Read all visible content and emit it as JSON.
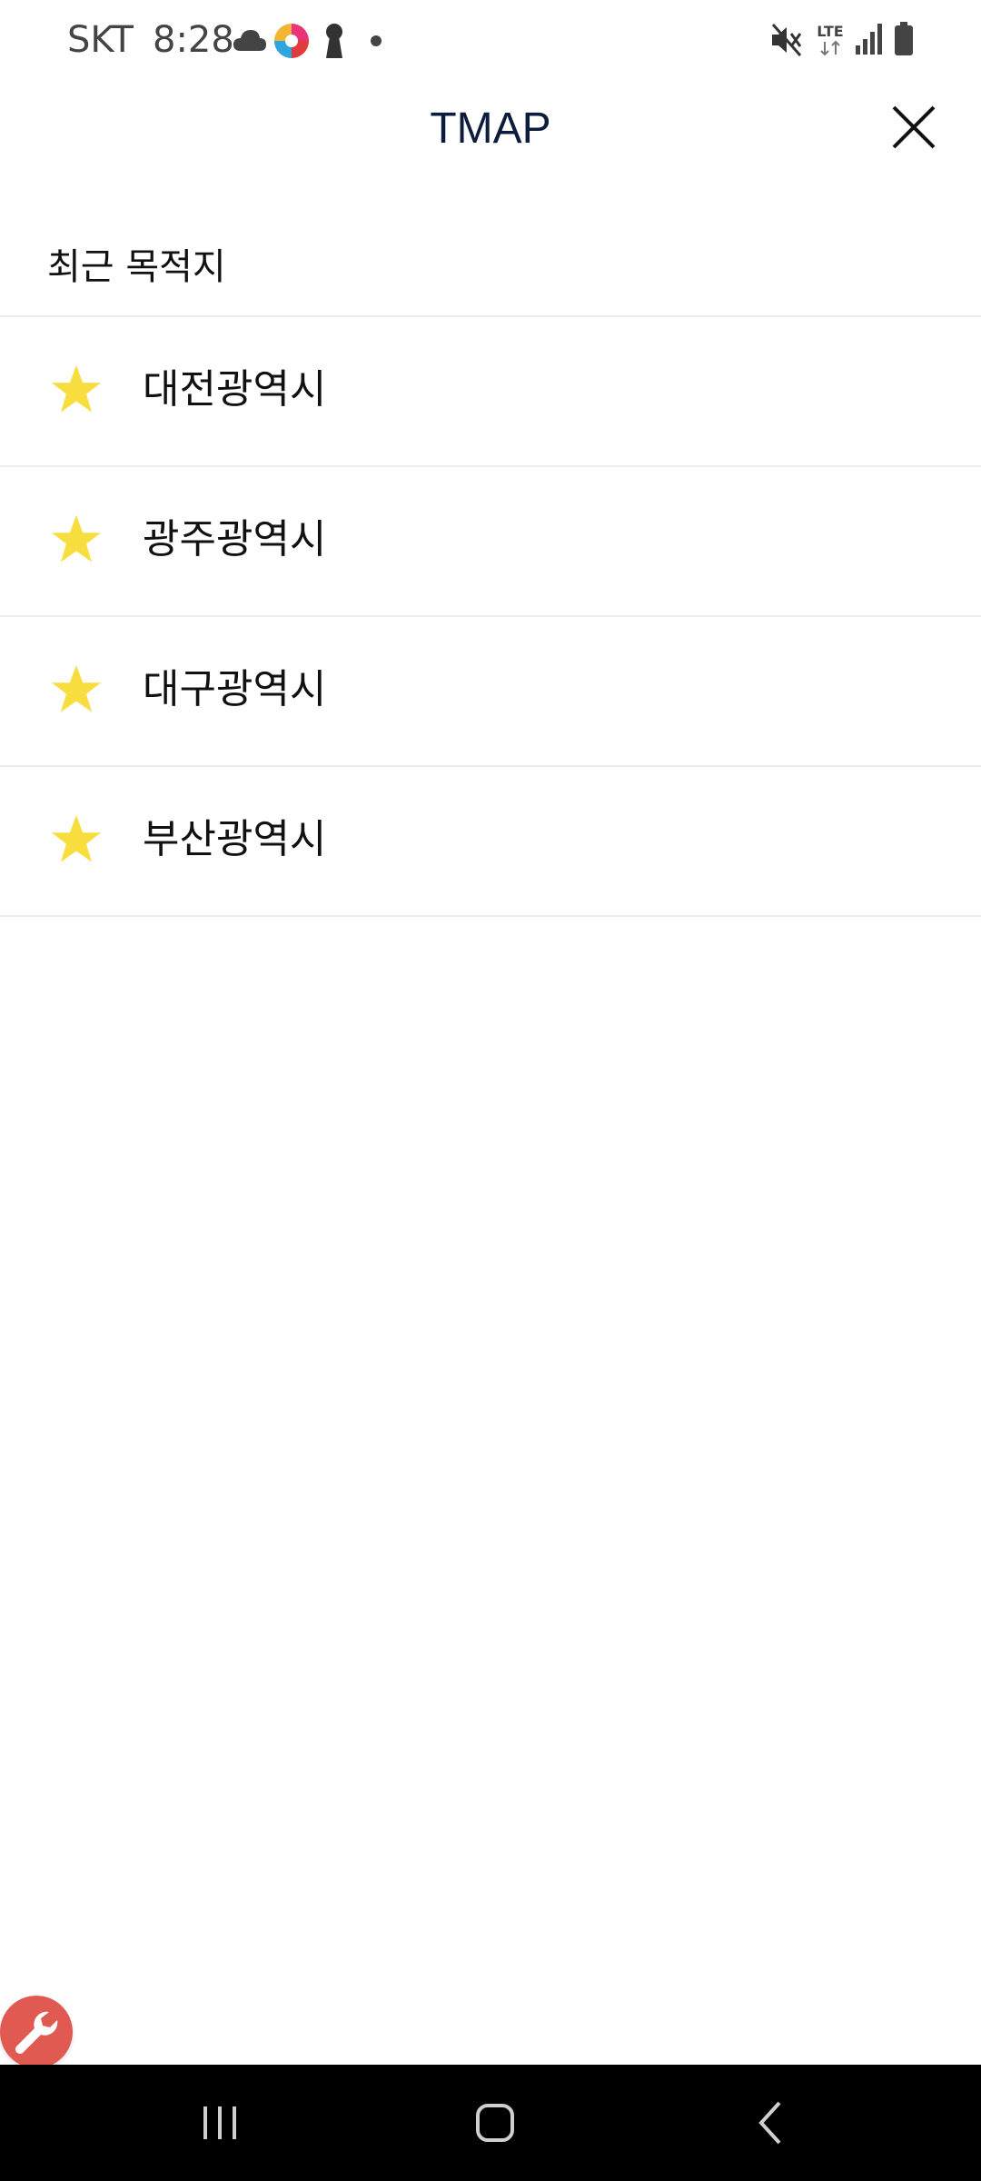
{
  "status_bar": {
    "carrier": "SKT",
    "time": "8:28",
    "icons": [
      "cloud-icon",
      "app-notification-icon",
      "keyhole-icon",
      "dot-icon",
      "mute-icon",
      "lte-icon",
      "signal-icon",
      "battery-icon"
    ],
    "lte_label": "LTE"
  },
  "header": {
    "title": "TMAP",
    "close_icon": "close-icon"
  },
  "section": {
    "title": "최근 목적지"
  },
  "destinations": [
    {
      "label": "대전광역시",
      "icon": "star-icon"
    },
    {
      "label": "광주광역시",
      "icon": "star-icon"
    },
    {
      "label": "대구광역시",
      "icon": "star-icon"
    },
    {
      "label": "부산광역시",
      "icon": "star-icon"
    }
  ],
  "fab": {
    "icon": "wrench-icon"
  },
  "navigation_bar": {
    "buttons": [
      "recents-icon",
      "home-icon",
      "back-icon"
    ]
  },
  "colors": {
    "title": "#0d1b3e",
    "star": "#f7dd3e",
    "divider": "#ececec",
    "fab": "#e05a52",
    "nav_bar": "#000000"
  }
}
